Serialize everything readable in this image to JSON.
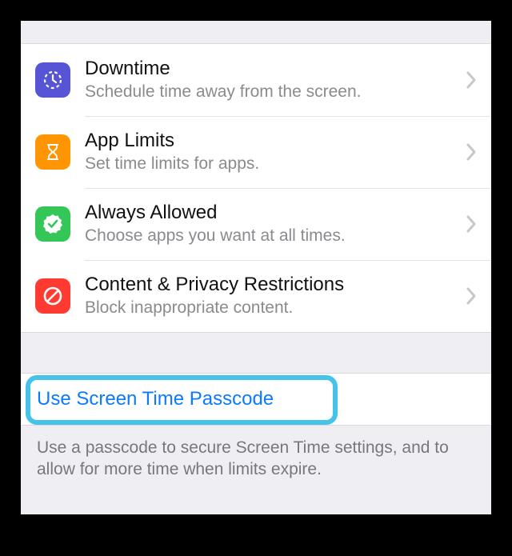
{
  "items": [
    {
      "title": "Downtime",
      "subtitle": "Schedule time away from the screen.",
      "icon": "downtime-icon",
      "color": "purple"
    },
    {
      "title": "App Limits",
      "subtitle": "Set time limits for apps.",
      "icon": "hourglass-icon",
      "color": "orange"
    },
    {
      "title": "Always Allowed",
      "subtitle": "Choose apps you want at all times.",
      "icon": "check-seal-icon",
      "color": "green"
    },
    {
      "title": "Content & Privacy Restrictions",
      "subtitle": "Block inappropriate content.",
      "icon": "no-symbol-icon",
      "color": "red"
    }
  ],
  "passcode": {
    "label": "Use Screen Time Passcode"
  },
  "footer": "Use a passcode to secure Screen Time settings, and to allow for more time when limits expire."
}
